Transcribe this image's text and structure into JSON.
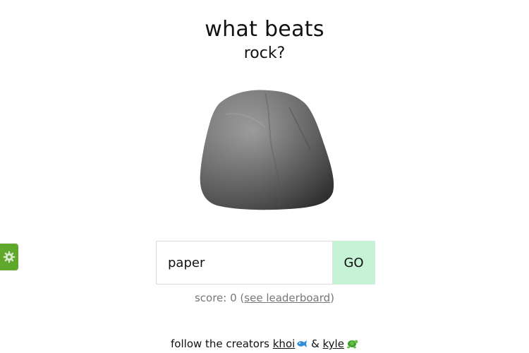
{
  "header": {
    "title": "what beats",
    "subject": "rock?"
  },
  "form": {
    "input_value": "paper",
    "go_label": "GO"
  },
  "score": {
    "prefix": "score: 0 (",
    "link_label": "see leaderboard",
    "suffix": ")"
  },
  "footer": {
    "prefix": "follow the creators ",
    "creator1": "khoi",
    "separator": " & ",
    "creator2": "kyle"
  },
  "icons": {
    "settings": "gear-icon",
    "creator1_icon": "fish-icon",
    "creator2_icon": "turtle-icon",
    "image": "rock-image"
  },
  "colors": {
    "go_button": "#c6f3d6",
    "settings_tab": "#5fa82c"
  }
}
